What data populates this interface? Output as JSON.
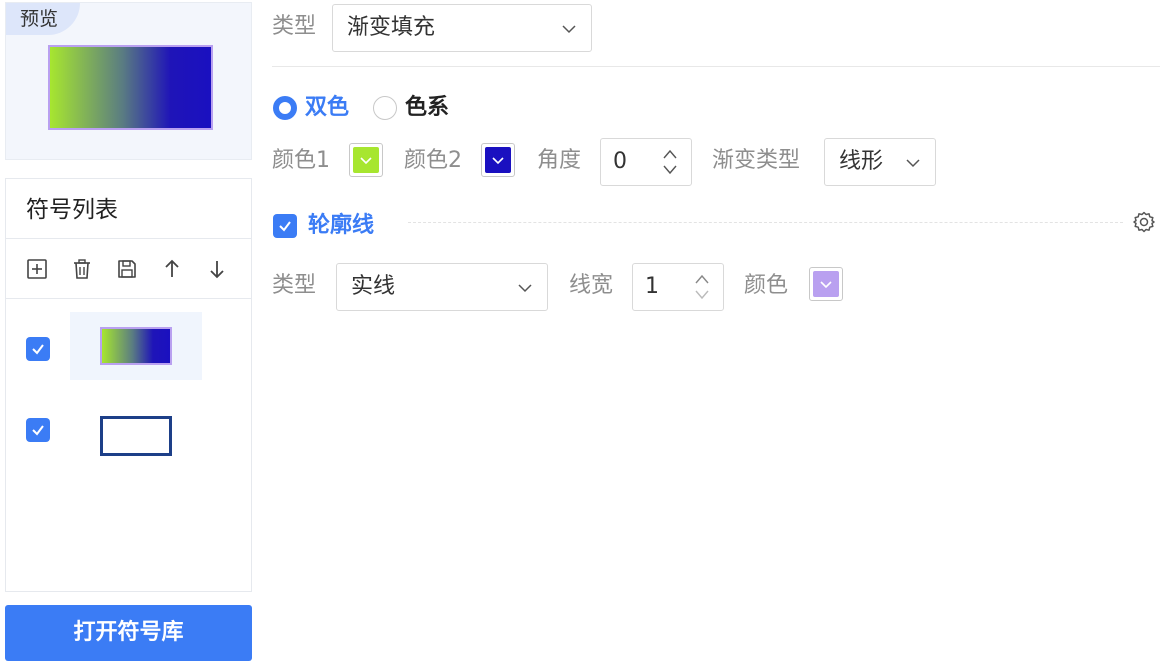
{
  "preview": {
    "tag": "预览"
  },
  "symbol_list": {
    "title": "符号列表",
    "toolbar": [
      {
        "icon": "add-icon"
      },
      {
        "icon": "delete-icon"
      },
      {
        "icon": "save-icon"
      },
      {
        "icon": "arrow-up-icon"
      },
      {
        "icon": "arrow-down-icon"
      }
    ],
    "items": [
      {
        "checked": true,
        "symbol": "gradient-fill",
        "selected": true
      },
      {
        "checked": true,
        "symbol": "outline-rect",
        "selected": false
      }
    ]
  },
  "open_library_button": "打开符号库",
  "fill": {
    "type_label": "类型",
    "type_value": "渐变填充",
    "mode_options": [
      {
        "label": "双色",
        "selected": true
      },
      {
        "label": "色系",
        "selected": false
      }
    ],
    "color1_label": "颜色1",
    "color1": "#a7e62f",
    "color2_label": "颜色2",
    "color2": "#1a10c0",
    "angle_label": "角度",
    "angle_value": "0",
    "gradient_type_label": "渐变类型",
    "gradient_type_value": "线形"
  },
  "outline": {
    "label": "轮廓线",
    "checked": true,
    "type_label": "类型",
    "type_value": "实线",
    "width_label": "线宽",
    "width_value": "1",
    "color_label": "颜色",
    "color": "#b9a0f0"
  },
  "colors": {
    "accent": "#3b7cf5",
    "gradient_start": "#a7e62f",
    "gradient_end": "#1a10c0",
    "outline_symbol": "#1d3f88"
  }
}
